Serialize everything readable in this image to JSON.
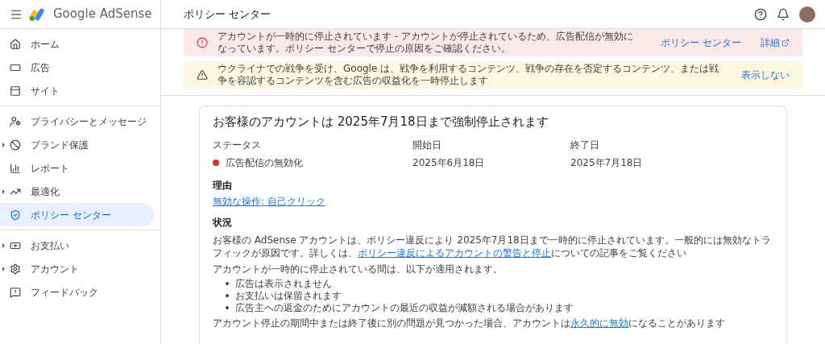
{
  "header": {
    "product": "Google AdSense",
    "page_title": "ポリシー センター"
  },
  "sidebar": {
    "groups": [
      [
        {
          "label": "ホーム",
          "expandable": false,
          "selected": false
        },
        {
          "label": "広告",
          "expandable": false,
          "selected": false
        },
        {
          "label": "サイト",
          "expandable": false,
          "selected": false
        }
      ],
      [
        {
          "label": "プライバシーとメッセージ",
          "expandable": false,
          "selected": false
        },
        {
          "label": "ブランド保護",
          "expandable": true,
          "selected": false
        },
        {
          "label": "レポート",
          "expandable": false,
          "selected": false
        },
        {
          "label": "最適化",
          "expandable": true,
          "selected": false
        },
        {
          "label": "ポリシー センター",
          "expandable": false,
          "selected": true
        }
      ],
      [
        {
          "label": "お支払い",
          "expandable": true,
          "selected": false
        },
        {
          "label": "アカウント",
          "expandable": true,
          "selected": false
        },
        {
          "label": "フィードバック",
          "expandable": false,
          "selected": false
        }
      ]
    ]
  },
  "banners": [
    {
      "kind": "error",
      "text": "アカウントが一時的に停止されています - アカウントが停止されているため、広告配信が無効になっています。ポリシー センターで停止の原因をご確認ください。",
      "actions": [
        {
          "label": "ポリシー センター",
          "external": false
        },
        {
          "label": "詳細",
          "external": true
        }
      ]
    },
    {
      "kind": "warning",
      "text": "ウクライナでの戦争を受け、Google は、戦争を利用するコンテンツ、戦争の存在を否定するコンテンツ、または戦争を容認するコンテンツを含む広告の収益化を一時停止します",
      "actions": [
        {
          "label": "表示しない",
          "external": false
        }
      ]
    }
  ],
  "card": {
    "title": "お客様のアカウントは 2025年7月18日まで強制停止されます",
    "fields": [
      {
        "label": "ステータス",
        "value": "広告配信の無効化",
        "color": "#d93025"
      },
      {
        "label": "開始日",
        "value": "2025年6月18日"
      },
      {
        "label": "終了日",
        "value": "2025年7月18日"
      }
    ],
    "reason_heading": "理由",
    "reason_link": "無効な操作: 自己クリック",
    "status_heading": "状況",
    "paragraph_1": [
      {
        "text": "お客様の AdSense アカウントは、ポリシー違反により 2025年7月18日まで一時的に停止されています。一般的には無効なトラフィックが原因です。詳しくは、",
        "link": false
      },
      {
        "text": "ポリシー違反によるアカウントの警告と停止",
        "link": true
      },
      {
        "text": "についての記事をご覧ください",
        "link": false
      }
    ],
    "paragraph_2": "アカウントが一時的に停止されている間は、以下が適用されます。",
    "bullets": [
      "広告は表示されません",
      "お支払いは保留されます",
      "広告主への返金のためにアカウントの最近の収益が減額される場合があります"
    ],
    "paragraph_3": [
      {
        "text": "アカウント停止の期間中または終了後に別の問題が見つかった場合、アカウントは",
        "link": false
      },
      {
        "text": "永久的に無効",
        "link": true
      },
      {
        "text": "になることがあります",
        "link": false
      }
    ]
  }
}
